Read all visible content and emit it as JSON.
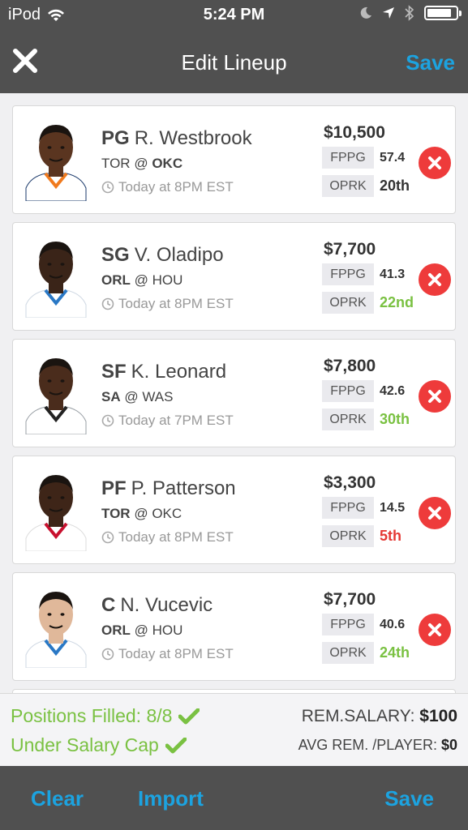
{
  "status_bar": {
    "carrier": "iPod",
    "time": "5:24 PM",
    "battery_level": 0.85
  },
  "nav": {
    "title": "Edit Lineup",
    "save_label": "Save",
    "close_icon": "close-x-icon"
  },
  "players": [
    {
      "position": "PG",
      "name": "R. Westbrook",
      "team": "TOR",
      "at": "@",
      "opponent": "OKC",
      "bold_side": "opponent",
      "time": "Today at 8PM EST",
      "salary": "$10,500",
      "fppg_label": "FPPG",
      "fppg": "57.4",
      "oprk_label": "OPRK",
      "oprk": "20th",
      "oprk_color": "#333333",
      "jersey": "white-orange",
      "skin": "#5a3520"
    },
    {
      "position": "SG",
      "name": "V. Oladipo",
      "team": "ORL",
      "at": "@",
      "opponent": "HOU",
      "bold_side": "team",
      "time": "Today at 8PM EST",
      "salary": "$7,700",
      "fppg_label": "FPPG",
      "fppg": "41.3",
      "oprk_label": "OPRK",
      "oprk": "22nd",
      "oprk_color": "#7ac142",
      "jersey": "white-blue",
      "skin": "#3a2418"
    },
    {
      "position": "SF",
      "name": "K. Leonard",
      "team": "SA",
      "at": "@",
      "opponent": "WAS",
      "bold_side": "team",
      "time": "Today at 7PM EST",
      "salary": "$7,800",
      "fppg_label": "FPPG",
      "fppg": "42.6",
      "oprk_label": "OPRK",
      "oprk": "30th",
      "oprk_color": "#7ac142",
      "jersey": "white-black",
      "skin": "#4a2c1c"
    },
    {
      "position": "PF",
      "name": "P. Patterson",
      "team": "TOR",
      "at": "@",
      "opponent": "OKC",
      "bold_side": "team",
      "time": "Today at 8PM EST",
      "salary": "$3,300",
      "fppg_label": "FPPG",
      "fppg": "14.5",
      "oprk_label": "OPRK",
      "oprk": "5th",
      "oprk_color": "#e53935",
      "jersey": "white-red",
      "skin": "#3e2518"
    },
    {
      "position": "C",
      "name": "N. Vucevic",
      "team": "ORL",
      "at": "@",
      "opponent": "HOU",
      "bold_side": "team",
      "time": "Today at 8PM EST",
      "salary": "$7,700",
      "fppg_label": "FPPG",
      "fppg": "40.6",
      "oprk_label": "OPRK",
      "oprk": "24th",
      "oprk_color": "#7ac142",
      "jersey": "white-blue",
      "skin": "#e0b89a"
    }
  ],
  "summary": {
    "positions_filled": "Positions Filled: 8/8",
    "under_cap": "Under Salary Cap",
    "rem_salary_label": "REM.SALARY:",
    "rem_salary_value": "$100",
    "avg_rem_label": "AVG REM. /PLAYER:",
    "avg_rem_value": "$0",
    "status_color": "#7ac142"
  },
  "toolbar": {
    "clear_label": "Clear",
    "import_label": "Import",
    "save_label": "Save"
  },
  "colors": {
    "accent": "#1ca3e0",
    "bar_background": "#505050",
    "remove": "#ee3b3b"
  }
}
